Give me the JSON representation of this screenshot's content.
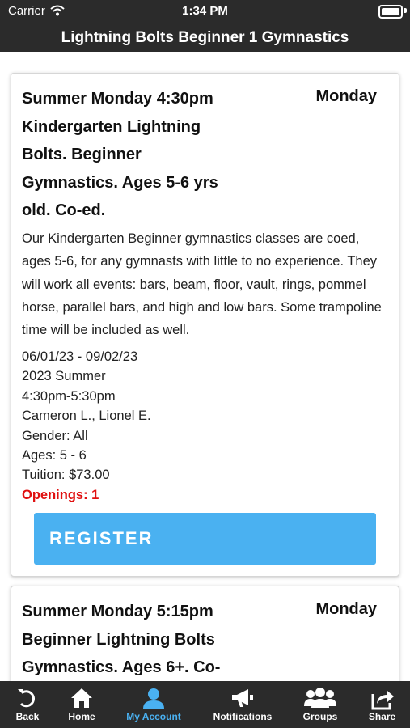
{
  "status_bar": {
    "carrier": "Carrier",
    "time": "1:34 PM"
  },
  "nav": {
    "title": "Lightning Bolts Beginner 1 Gymnastics"
  },
  "classes": [
    {
      "title": "Summer Monday 4:30pm Kindergarten Lightning Bolts. Beginner Gymnastics. Ages 5-6 yrs old. Co-ed.",
      "day": "Monday",
      "description": "Our Kindergarten Beginner gymnastics classes are coed, ages 5-6, for any gymnasts with little to no experience. They will work all events: bars, beam, floor, vault, rings, pommel horse, parallel bars, and high and low bars. Some trampoline time will be included as well.",
      "dates": "06/01/23 - 09/02/23",
      "session": "2023 Summer",
      "time": "4:30pm-5:30pm",
      "instructors": "Cameron L., Lionel E.",
      "gender": "Gender: All",
      "ages": "Ages: 5 - 6",
      "tuition": "Tuition: $73.00",
      "openings": "Openings: 1",
      "register_label": "REGISTER"
    },
    {
      "title": "Summer Monday 5:15pm Beginner Lightning Bolts Gymnastics. Ages 6+. Co-",
      "day": "Monday"
    }
  ],
  "tabbar": {
    "items": [
      {
        "label": "Back",
        "icon": "back-arrow-icon"
      },
      {
        "label": "Home",
        "icon": "home-icon"
      },
      {
        "label": "My Account",
        "icon": "user-icon"
      },
      {
        "label": "Notifications",
        "icon": "megaphone-icon"
      },
      {
        "label": "Groups",
        "icon": "groups-icon"
      },
      {
        "label": "Share",
        "icon": "share-icon"
      }
    ],
    "active": "My Account",
    "active_color": "#4ab1f1"
  },
  "colors": {
    "bar": "#2b2b2b",
    "accent": "#4ab1f1",
    "openings": "#e01010"
  }
}
